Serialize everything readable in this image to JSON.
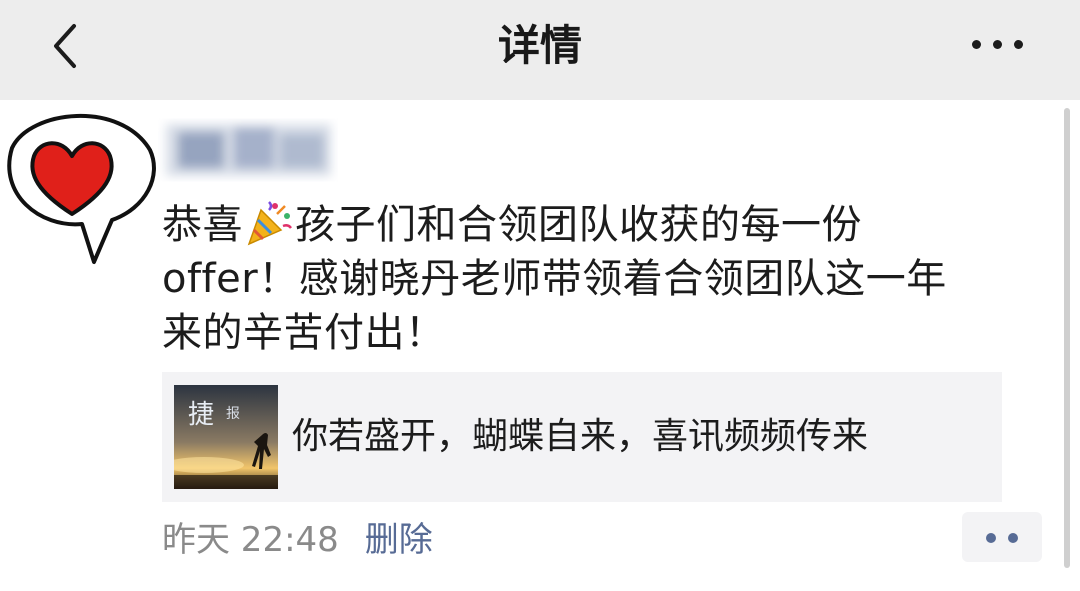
{
  "header": {
    "title": "详情",
    "back_icon": "chevron-left-icon",
    "more_icon": "more-horizontal-icon"
  },
  "sticker": {
    "icon": "heart-speech-bubble-icon",
    "heart_color": "#e0201a"
  },
  "post": {
    "lines": [
      {
        "before": "恭喜",
        "emoji": "party-popper-icon",
        "after": "孩子们和合领团队收获的每一份"
      },
      "offer！感谢晓丹老师带领着合领团队这一年",
      "来的辛苦付出！"
    ]
  },
  "link_card": {
    "thumbnail_text": [
      "捷",
      "报"
    ],
    "title": "你若盛开，蝴蝶自来，喜讯频频传来"
  },
  "meta": {
    "time": "昨天 22:48",
    "delete_label": "删除",
    "link_color": "#576b95"
  },
  "actions": {
    "icon": "comment-like-menu-icon"
  }
}
